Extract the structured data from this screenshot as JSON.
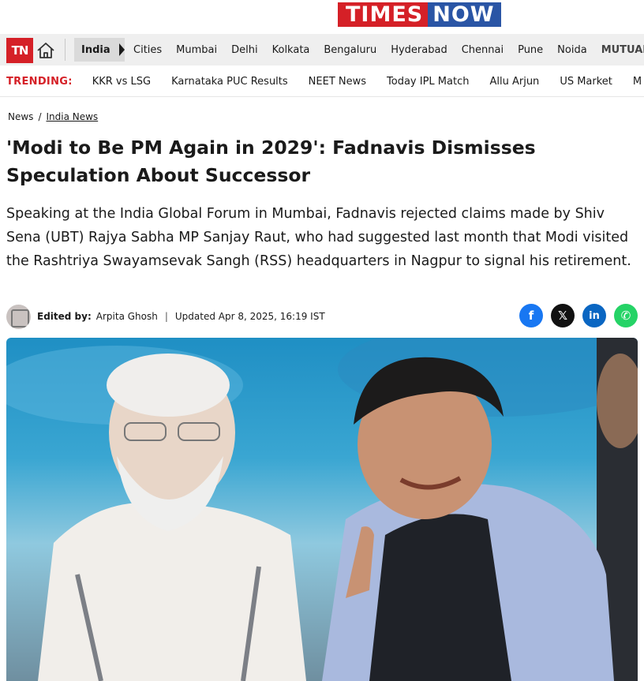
{
  "brand": {
    "times": "TIMES",
    "now": "NOW"
  },
  "nav": {
    "logo": "TN",
    "active": "India",
    "items": [
      "Cities",
      "Mumbai",
      "Delhi",
      "Kolkata",
      "Bengaluru",
      "Hyderabad",
      "Chennai",
      "Pune",
      "Noida",
      "MUTUAL"
    ]
  },
  "trending": {
    "label": "TRENDING:",
    "items": [
      "KKR vs LSG",
      "Karnataka PUC Results",
      "NEET News",
      "Today IPL Match",
      "Allu Arjun",
      "US Market",
      "M"
    ]
  },
  "breadcrumb": {
    "home": "News",
    "sep": "/",
    "section": "India News"
  },
  "article": {
    "headline": "'Modi to Be PM Again in 2029': Fadnavis Dismisses Speculation About Successor",
    "summary": "Speaking at the India Global Forum in Mumbai, Fadnavis rejected claims made by Shiv Sena (UBT) Rajya Sabha MP Sanjay Raut, who had suggested last month that Modi visited the Rashtriya Swayamsevak Sangh (RSS) headquarters in Nagpur to signal his retirement.",
    "edited_label": "Edited by:",
    "editor": "Arpita Ghosh",
    "separator": "|",
    "updated": "Updated Apr 8, 2025, 16:19 IST"
  },
  "share": {
    "facebook": "f",
    "x": "𝕏",
    "linkedin": "in",
    "whatsapp": "✆"
  },
  "colors": {
    "brand_red": "#d52027",
    "brand_blue": "#2a55a5",
    "trending_red": "#d52027"
  }
}
